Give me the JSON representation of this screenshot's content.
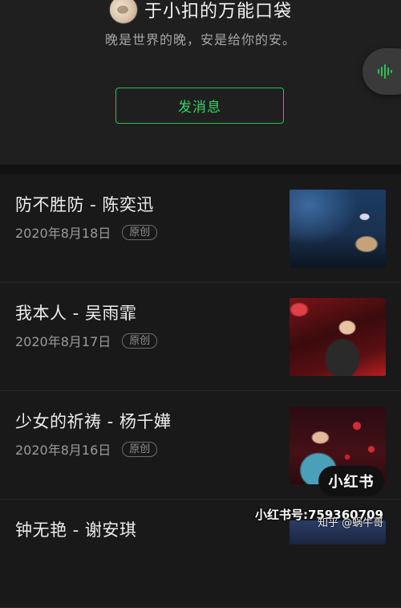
{
  "profile": {
    "name": "于小扣的万能口袋",
    "motto": "晚是世界的晚，安是给你的安。",
    "message_button": "发消息",
    "voice_icon": "audio-wave-icon"
  },
  "articles": [
    {
      "title": "防不胜防 - 陈奕迅",
      "date": "2020年8月18日",
      "badge": "原创"
    },
    {
      "title": "我本人 - 吴雨霏",
      "date": "2020年8月17日",
      "badge": "原创"
    },
    {
      "title": "少女的祈祷 - 杨千嬅",
      "date": "2020年8月16日",
      "badge": "原创"
    },
    {
      "title": "钟无艳 - 谢安琪",
      "date": "",
      "badge": ""
    }
  ],
  "overlay": {
    "xhs_logo": "小红书",
    "xhs_id": "小红书号:759360709",
    "zhihu": "知乎 @蜗牛哥"
  },
  "colors": {
    "accent_green": "#3bcf67",
    "background": "#191919"
  }
}
